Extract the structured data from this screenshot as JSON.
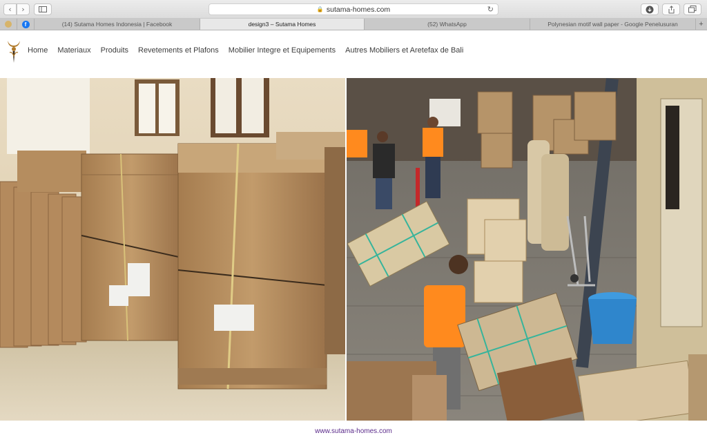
{
  "browser": {
    "url": "sutama-homes.com",
    "tabs": [
      {
        "label": "(14) Sutama Homes Indonesia | Facebook",
        "active": false
      },
      {
        "label": "design3 – Sutama Homes",
        "active": true
      },
      {
        "label": "(52) WhatsApp",
        "active": false
      },
      {
        "label": "Polynesian motif wall paper - Google Penelusuran",
        "active": false
      }
    ],
    "icons": [
      "chevron-left-icon",
      "chevron-right-icon",
      "sidebar-icon",
      "lock-icon",
      "reload-icon",
      "download-icon",
      "share-icon",
      "tabs-icon",
      "facebook-icon",
      "plus-icon"
    ]
  },
  "nav": {
    "items": [
      "Home",
      "Materiaux",
      "Produits",
      "Revetements et Plafons",
      "Mobilier Integre et Equipements",
      "Autres Mobiliers et Aretefax de Bali"
    ]
  },
  "footer": {
    "link": "www.sutama-homes.com"
  },
  "colors": {
    "link": "#5a2a8a",
    "cardboard": "#b58a5c",
    "shirt": "#ff8a1e"
  }
}
